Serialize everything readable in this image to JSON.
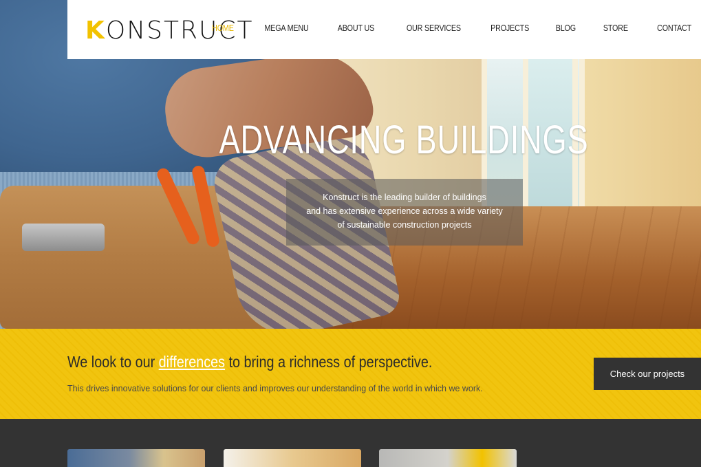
{
  "header": {
    "logo_text": "KONSTRUCT",
    "nav": [
      {
        "label": "HOME",
        "active": true
      },
      {
        "label": "MEGA MENU"
      },
      {
        "label": "ABOUT US"
      },
      {
        "label": "OUR SERVICES"
      },
      {
        "label": "PROJECTS"
      },
      {
        "label": "BLOG"
      },
      {
        "label": "STORE"
      },
      {
        "label": "CONTACT"
      }
    ]
  },
  "hero": {
    "title": "ADVANCING BUILDINGS",
    "lines": [
      "Konstruct is the leading builder of buildings",
      "and has extensive experience across a wide variety",
      "of sustainable construction projects"
    ]
  },
  "band": {
    "heading_pre": "We look to our",
    "heading_highlight": "differences",
    "heading_post": "to bring a richness of perspective.",
    "subtext": "This drives innovative solutions for our clients and improves our understanding of the world in which we work.",
    "cta_label": "Check our projects"
  },
  "colors": {
    "accent": "#f2c200",
    "dark": "#333333"
  },
  "icons": [
    "logo"
  ]
}
